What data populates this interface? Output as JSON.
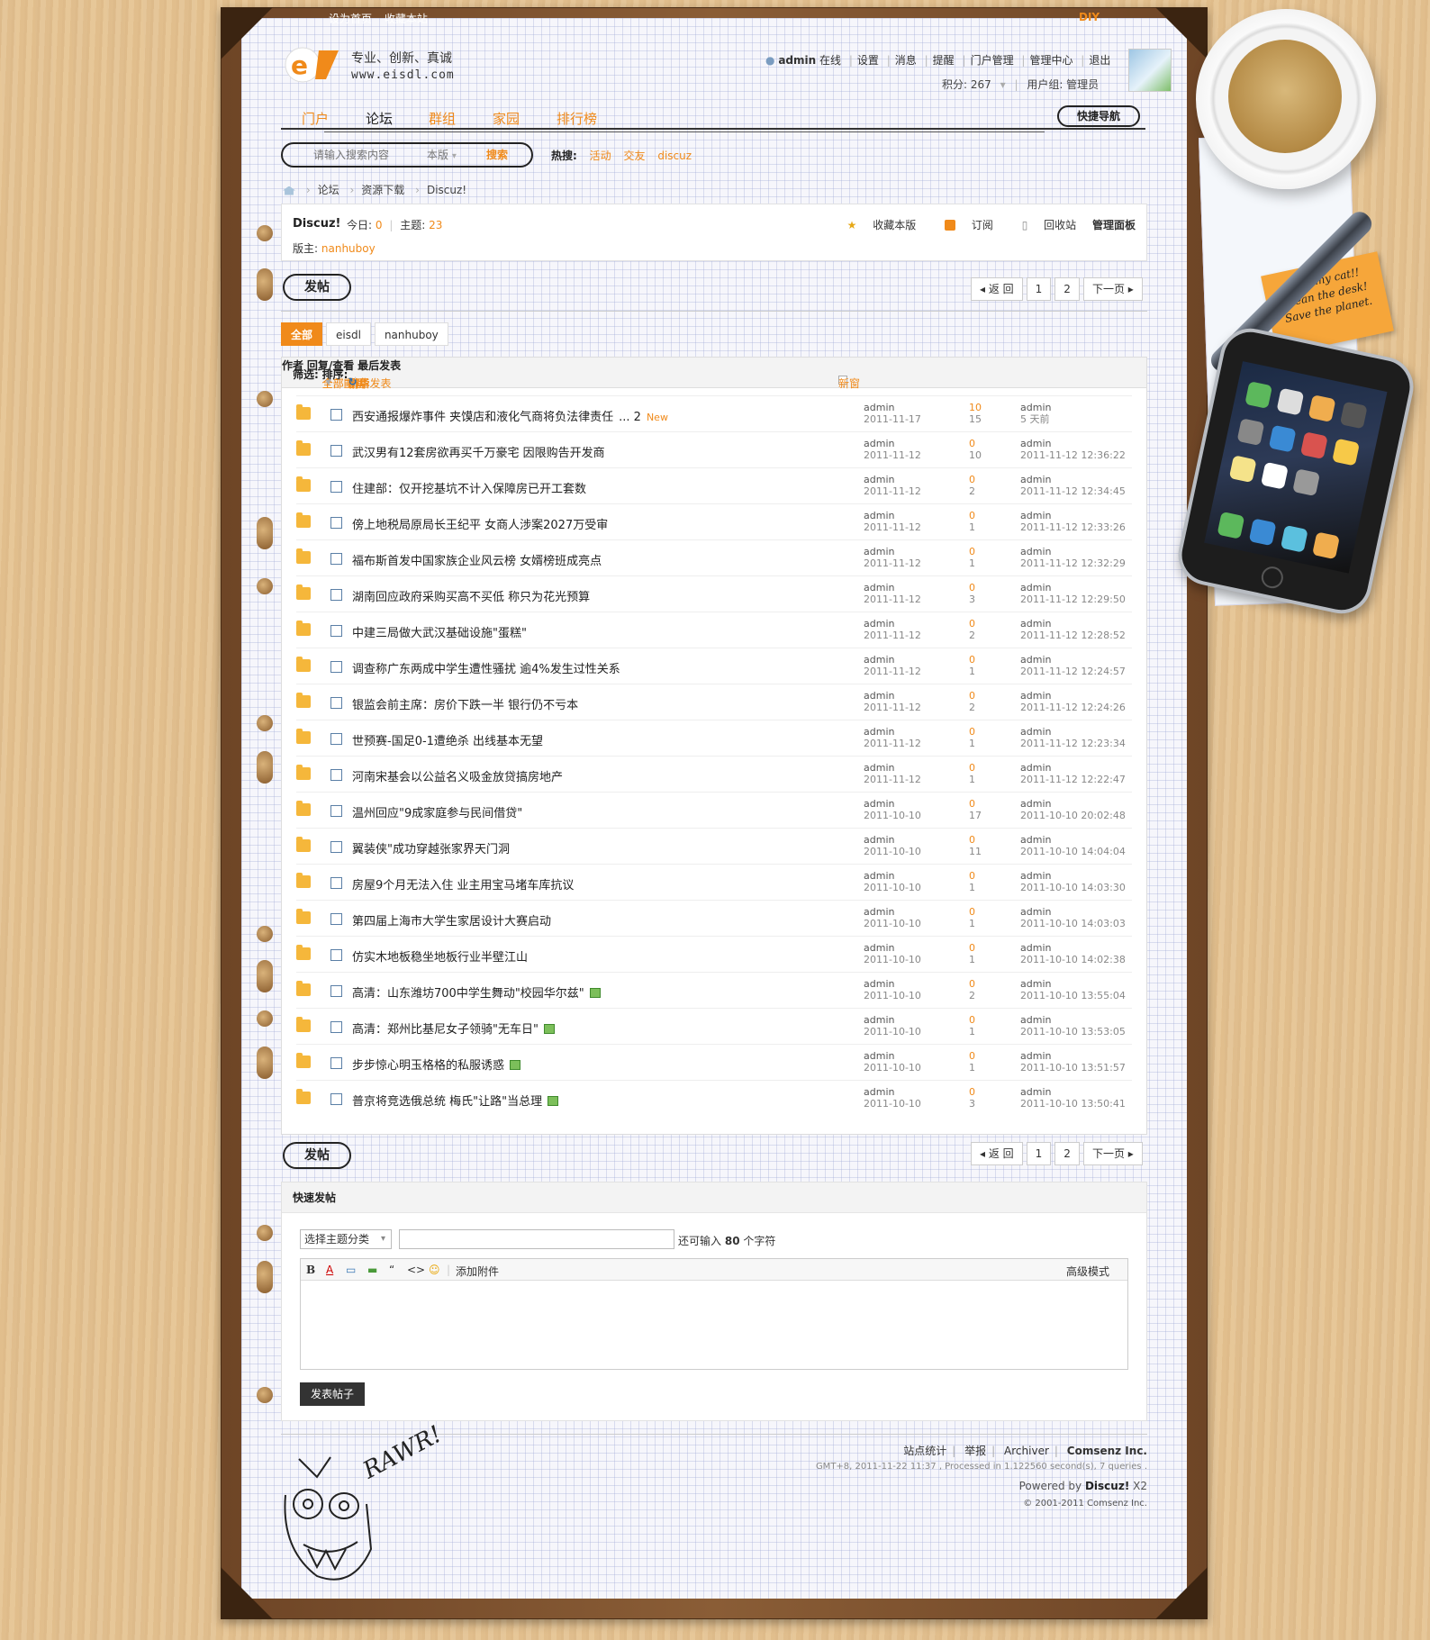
{
  "topbar": {
    "set_home": "设为首页",
    "bookmark": "收藏本站",
    "diy": "DIY"
  },
  "header": {
    "slogan": "专业、创新、真诚",
    "url": "www.eisdl.com",
    "user": "admin",
    "online": "在线",
    "menu": [
      "设置",
      "消息",
      "提醒",
      "门户管理",
      "管理中心",
      "退出"
    ],
    "points_label": "积分: 267",
    "group_label": "用户组: 管理员"
  },
  "nav": {
    "items": [
      "门户",
      "论坛",
      "群组",
      "家园",
      "排行榜"
    ],
    "active": 1,
    "quick_nav": "快捷导航"
  },
  "search": {
    "placeholder": "请输入搜索内容",
    "scope": "本版",
    "button": "搜索",
    "hot_label": "热搜:",
    "hot": [
      "活动",
      "交友",
      "discuz"
    ]
  },
  "breadcrumb": [
    "论坛",
    "资源下载",
    "Discuz!"
  ],
  "forum": {
    "name": "Discuz!",
    "today_label": "今日:",
    "today": "0",
    "threads_label": "主题:",
    "threads": "23",
    "moderator_label": "版主:",
    "moderator": "nanhuboy",
    "actions": [
      "收藏本版",
      "订阅",
      "回收站",
      "管理面板"
    ]
  },
  "toolbar": {
    "post_label": "发帖",
    "back": "◂ 返 回",
    "pages": [
      "1",
      "2"
    ],
    "next": "下一页 ▸"
  },
  "filter_tabs": [
    "全部",
    "eisdl",
    "nanhuboy"
  ],
  "table_header": {
    "filter_label": "筛选:",
    "all_topics": "全部主题",
    "all_time": "全部时间",
    "sort_label": "排序:",
    "sort": "最后发表",
    "digest": "精华",
    "refresh": "↻",
    "new_window": "新窗",
    "author": "作者",
    "reply_view": "回复/查看",
    "last_post": "最后发表"
  },
  "threads": [
    {
      "title": "西安通报爆炸事件 夹馍店和液化气商将负法律责任",
      "pages": "... 2",
      "new": "New",
      "author": "admin",
      "date": "2011-11-17",
      "replies": "10",
      "views": "15",
      "last_user": "admin",
      "last_time": "5 天前",
      "image": false
    },
    {
      "title": "武汉男有12套房欲再买千万豪宅 因限购告开发商",
      "author": "admin",
      "date": "2011-11-12",
      "replies": "0",
      "views": "10",
      "last_user": "admin",
      "last_time": "2011-11-12 12:36:22",
      "image": false
    },
    {
      "title": "住建部：仅开挖基坑不计入保障房已开工套数",
      "author": "admin",
      "date": "2011-11-12",
      "replies": "0",
      "views": "2",
      "last_user": "admin",
      "last_time": "2011-11-12 12:34:45",
      "image": false
    },
    {
      "title": "傍上地税局原局长王纪平 女商人涉案2027万受审",
      "author": "admin",
      "date": "2011-11-12",
      "replies": "0",
      "views": "1",
      "last_user": "admin",
      "last_time": "2011-11-12 12:33:26",
      "image": false
    },
    {
      "title": "福布斯首发中国家族企业风云榜 女婿榜班成亮点",
      "author": "admin",
      "date": "2011-11-12",
      "replies": "0",
      "views": "1",
      "last_user": "admin",
      "last_time": "2011-11-12 12:32:29",
      "image": false
    },
    {
      "title": "湖南回应政府采购买高不买低 称只为花光预算",
      "author": "admin",
      "date": "2011-11-12",
      "replies": "0",
      "views": "3",
      "last_user": "admin",
      "last_time": "2011-11-12 12:29:50",
      "image": false
    },
    {
      "title": "中建三局做大武汉基础设施\"蛋糕\"",
      "author": "admin",
      "date": "2011-11-12",
      "replies": "0",
      "views": "2",
      "last_user": "admin",
      "last_time": "2011-11-12 12:28:52",
      "image": false
    },
    {
      "title": "调查称广东两成中学生遭性骚扰 逾4%发生过性关系",
      "author": "admin",
      "date": "2011-11-12",
      "replies": "0",
      "views": "1",
      "last_user": "admin",
      "last_time": "2011-11-12 12:24:57",
      "image": false
    },
    {
      "title": "银监会前主席：房价下跌一半 银行仍不亏本",
      "author": "admin",
      "date": "2011-11-12",
      "replies": "0",
      "views": "2",
      "last_user": "admin",
      "last_time": "2011-11-12 12:24:26",
      "image": false
    },
    {
      "title": "世预赛-国足0-1遭绝杀 出线基本无望",
      "author": "admin",
      "date": "2011-11-12",
      "replies": "0",
      "views": "1",
      "last_user": "admin",
      "last_time": "2011-11-12 12:23:34",
      "image": false
    },
    {
      "title": "河南宋基会以公益名义吸金放贷搞房地产",
      "author": "admin",
      "date": "2011-11-12",
      "replies": "0",
      "views": "1",
      "last_user": "admin",
      "last_time": "2011-11-12 12:22:47",
      "image": false
    },
    {
      "title": "温州回应\"9成家庭参与民间借贷\"",
      "author": "admin",
      "date": "2011-10-10",
      "replies": "0",
      "views": "17",
      "last_user": "admin",
      "last_time": "2011-10-10 20:02:48",
      "image": false
    },
    {
      "title": "翼装侠\"成功穿越张家界天门洞",
      "author": "admin",
      "date": "2011-10-10",
      "replies": "0",
      "views": "11",
      "last_user": "admin",
      "last_time": "2011-10-10 14:04:04",
      "image": false
    },
    {
      "title": "房屋9个月无法入住 业主用宝马堵车库抗议",
      "author": "admin",
      "date": "2011-10-10",
      "replies": "0",
      "views": "1",
      "last_user": "admin",
      "last_time": "2011-10-10 14:03:30",
      "image": false
    },
    {
      "title": "第四届上海市大学生家居设计大赛启动",
      "author": "admin",
      "date": "2011-10-10",
      "replies": "0",
      "views": "1",
      "last_user": "admin",
      "last_time": "2011-10-10 14:03:03",
      "image": false
    },
    {
      "title": "仿实木地板稳坐地板行业半壁江山",
      "author": "admin",
      "date": "2011-10-10",
      "replies": "0",
      "views": "1",
      "last_user": "admin",
      "last_time": "2011-10-10 14:02:38",
      "image": false
    },
    {
      "title": "高清：山东潍坊700中学生舞动\"校园华尔兹\"",
      "author": "admin",
      "date": "2011-10-10",
      "replies": "0",
      "views": "2",
      "last_user": "admin",
      "last_time": "2011-10-10 13:55:04",
      "image": true
    },
    {
      "title": "高清：郑州比基尼女子领骑\"无车日\"",
      "author": "admin",
      "date": "2011-10-10",
      "replies": "0",
      "views": "1",
      "last_user": "admin",
      "last_time": "2011-10-10 13:53:05",
      "image": true
    },
    {
      "title": "步步惊心明玉格格的私服诱惑",
      "author": "admin",
      "date": "2011-10-10",
      "replies": "0",
      "views": "1",
      "last_user": "admin",
      "last_time": "2011-10-10 13:51:57",
      "image": true
    },
    {
      "title": "普京将竞选俄总统 梅氏\"让路\"当总理",
      "author": "admin",
      "date": "2011-10-10",
      "replies": "0",
      "views": "3",
      "last_user": "admin",
      "last_time": "2011-10-10 13:50:41",
      "image": true
    }
  ],
  "quick_post": {
    "title": "快速发帖",
    "category": "选择主题分类",
    "remain_prefix": "还可输入",
    "remain_count": "80",
    "remain_suffix": "个字符",
    "toolbar": [
      "B",
      "A",
      "▭",
      "▬",
      "“",
      "<>",
      "☺"
    ],
    "attach": "添加附件",
    "advanced": "高级模式",
    "submit": "发表帖子"
  },
  "footer": {
    "links": [
      "站点统计",
      "举报",
      "Archiver",
      "Comsenz Inc."
    ],
    "stats": "GMT+8, 2011-11-22 11:37 , Processed in 1.122560 second(s), 7 queries .",
    "powered_prefix": "Powered by",
    "powered_name": "Discuz!",
    "powered_version": "X2",
    "copyright": "© 2001-2011 Comsenz Inc."
  },
  "desk": {
    "note_lines": [
      "Feed my cat!!",
      "Clean the desk!",
      "Save the planet."
    ],
    "rawr": "RAWR!"
  },
  "colors": {
    "accent": "#f08a1a",
    "paper": "#f6f6fb",
    "frame": "#7a5030"
  }
}
